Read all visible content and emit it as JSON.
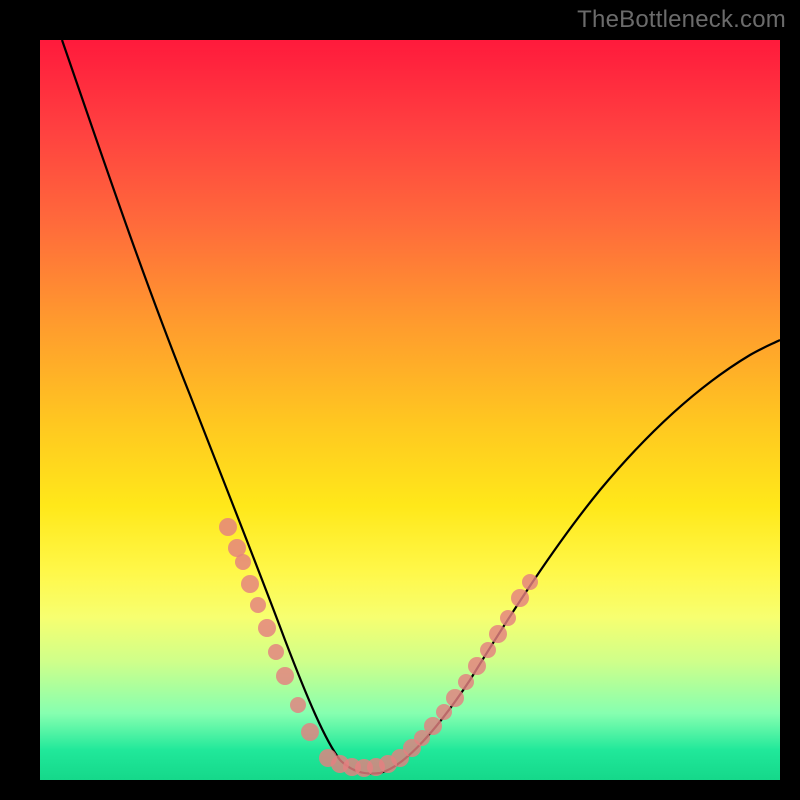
{
  "watermark": {
    "text": "TheBottleneck.com"
  },
  "chart_data": {
    "type": "line",
    "title": "",
    "xlabel": "",
    "ylabel": "",
    "xlim": [
      0,
      100
    ],
    "ylim": [
      0,
      100
    ],
    "grid": false,
    "legend": false,
    "series": [
      {
        "name": "bottleneck-curve",
        "color": "#000000",
        "x": [
          3,
          8,
          13,
          18,
          22,
          25,
          28,
          30,
          32,
          34,
          36,
          38,
          40,
          42,
          45,
          50,
          55,
          60,
          65,
          70,
          75,
          80,
          85,
          90,
          95,
          100
        ],
        "y": [
          100,
          85,
          70,
          56,
          44,
          35,
          27,
          21,
          16,
          11,
          7,
          4,
          2,
          2,
          2,
          5,
          10,
          16,
          22,
          28,
          33,
          38,
          43,
          48,
          52,
          56
        ]
      }
    ],
    "markers": [
      {
        "name": "left-cluster",
        "color": "#e68585",
        "x": [
          25,
          26.5,
          27,
          28,
          29,
          30,
          31,
          32,
          34,
          36
        ],
        "y": [
          33,
          30,
          29,
          26,
          23,
          20,
          17,
          14,
          10,
          6
        ]
      },
      {
        "name": "bottom-cluster",
        "color": "#e68585",
        "x": [
          38,
          39.5,
          41,
          42.5,
          44,
          45.5,
          47
        ],
        "y": [
          2.5,
          2.2,
          2.0,
          2.0,
          2.2,
          2.6,
          3.2
        ]
      },
      {
        "name": "right-cluster",
        "color": "#e68585",
        "x": [
          48,
          49,
          50.5,
          52,
          53.5,
          55,
          56.5,
          58,
          59.5,
          61,
          63,
          64.5
        ],
        "y": [
          4,
          5,
          6.5,
          8,
          9.5,
          11,
          13,
          15,
          17,
          19,
          22,
          24
        ]
      }
    ],
    "optimal_band": {
      "y_range_pct": [
        0,
        4
      ],
      "color": "#15d88a"
    }
  }
}
